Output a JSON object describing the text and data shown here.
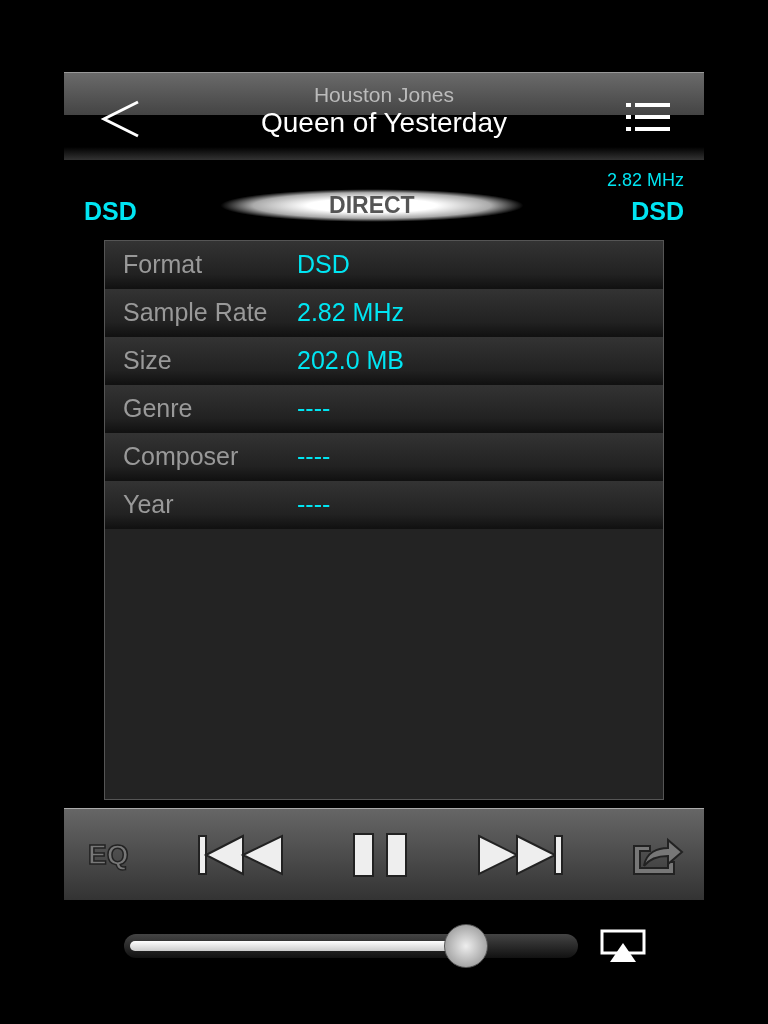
{
  "header": {
    "artist": "Houston Jones",
    "title": "Queen of Yesterday"
  },
  "signal": {
    "source_format": "DSD",
    "mode": "DIRECT",
    "output_rate": "2.82 MHz",
    "output_format": "DSD"
  },
  "info_rows": [
    {
      "label": "Format",
      "value": "DSD"
    },
    {
      "label": "Sample Rate",
      "value": "2.82 MHz"
    },
    {
      "label": "Size",
      "value": "202.0 MB"
    },
    {
      "label": "Genre",
      "value": "----"
    },
    {
      "label": "Composer",
      "value": "----"
    },
    {
      "label": "Year",
      "value": "----"
    }
  ],
  "controls": {
    "eq_label": "EQ",
    "playing": true
  },
  "volume": {
    "level": 0.78
  }
}
